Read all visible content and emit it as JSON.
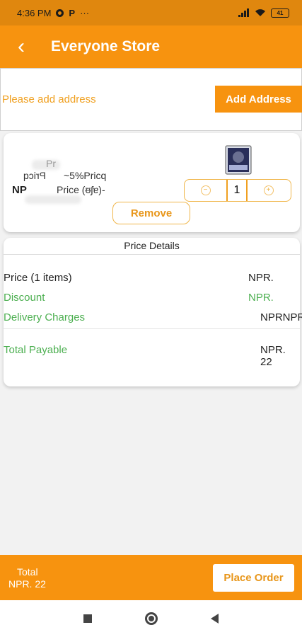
{
  "status_bar": {
    "time": "4:36 PM",
    "extra_letter": "P",
    "dots": "···",
    "battery": "41"
  },
  "app_bar": {
    "back_glyph": "‹",
    "title": "Everyone Store"
  },
  "address": {
    "prompt": "Please add address",
    "button_label": "Add Address"
  },
  "product": {
    "garbled_lines": [
      "Pr",
      "Pricq",
      "~5%Pricq",
      "NP",
      "Price (ᵿʃɐ)-"
    ],
    "quantity": "1",
    "minus_glyph": "−",
    "plus_glyph": "+",
    "remove_label": "Remove"
  },
  "price_details": {
    "header": "Price Details",
    "rows": [
      {
        "label": "Price (1 items)",
        "value": "NPR."
      },
      {
        "label": "Discount",
        "value": "NPR."
      },
      {
        "label": "Delivery Charges",
        "value": "NPRNPR"
      }
    ],
    "total": {
      "label": "Total Payable",
      "value": "NPR. 22"
    }
  },
  "bottom_bar": {
    "total_label": "Total",
    "total_value": "NPR. 22",
    "place_order_label": "Place Order"
  },
  "colors": {
    "primary": "#f7930f",
    "status": "#e0870e",
    "green": "#4caf50",
    "accent_text": "#e8961a"
  }
}
